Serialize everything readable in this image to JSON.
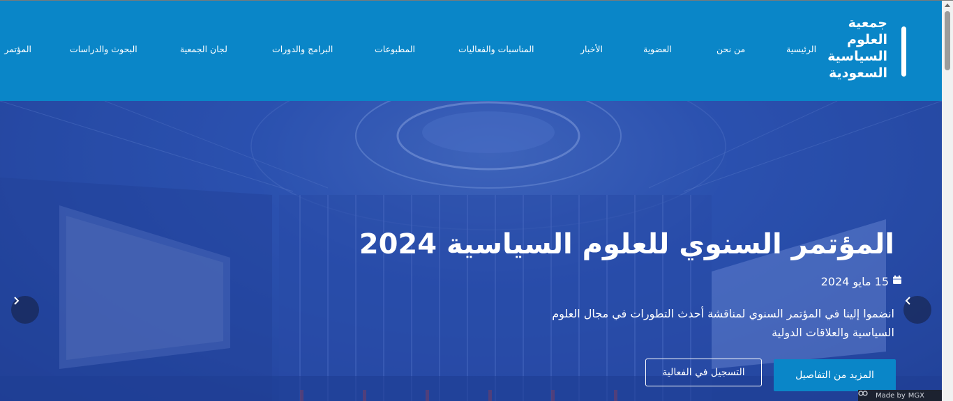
{
  "brand": {
    "lines": [
      "جمعية",
      "العلوم",
      "السياسية",
      "السعودية"
    ]
  },
  "nav": {
    "items": [
      {
        "label": "الرئيسية"
      },
      {
        "label": "من نحن"
      },
      {
        "label": "العضوية"
      },
      {
        "label": "الأخبار"
      },
      {
        "label": "المناسبات والفعاليات"
      },
      {
        "label": "المطبوعات"
      },
      {
        "label": "البرامج والدورات"
      },
      {
        "label": "لجان الجمعية"
      },
      {
        "label": "البحوث والدراسات"
      },
      {
        "label": "المؤتمر"
      }
    ]
  },
  "hero": {
    "title": "المؤتمر السنوي للعلوم السياسية 2024",
    "date": "15 مايو 2024",
    "description": "انضموا إلينا في المؤتمر السنوي لمناقشة أحدث التطورات في مجال العلوم السياسية والعلاقات الدولية",
    "primary_button": "المزيد من التفاصيل",
    "secondary_button": "التسجيل في الفعالية"
  },
  "badge": {
    "made_by": "Made by",
    "brand": "MGX"
  },
  "icons": {
    "calendar": "calendar-icon",
    "prev": "chevron-left-icon",
    "next": "chevron-right-icon"
  },
  "colors": {
    "header_bg": "#0a86c8",
    "primary_button": "#0a86c8",
    "hero_tint": "#2f57b2"
  }
}
